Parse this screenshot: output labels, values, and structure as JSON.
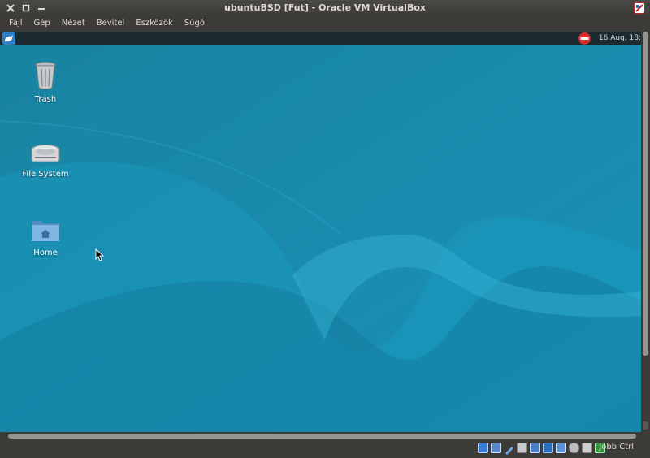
{
  "window": {
    "title": "ubuntuBSD [Fut] - Oracle VM VirtualBox"
  },
  "menubar": {
    "items": [
      "Fájl",
      "Gép",
      "Nézet",
      "Bevitel",
      "Eszközök",
      "Súgó"
    ]
  },
  "guest": {
    "panel": {
      "clock": "16 Aug, 18:"
    },
    "desktop_icons": [
      {
        "label": "Trash",
        "icon": "trash-icon"
      },
      {
        "label": "File System",
        "icon": "hard-drive-icon"
      },
      {
        "label": "Home",
        "icon": "home-folder-icon"
      }
    ]
  },
  "statusbar": {
    "host_key_label": "Jobb Ctrl",
    "icons": [
      "harddisk-icon",
      "optical-drive-icon",
      "audio-icon",
      "network-icon",
      "usb-icon",
      "shared-folders-icon",
      "display-icon",
      "video-capture-icon",
      "mouse-integration-icon",
      "keyboard-capture-icon"
    ]
  },
  "colors": {
    "desktop": "#1a89ad",
    "chrome": "#3c3b37",
    "panel": "#1d2a30"
  }
}
